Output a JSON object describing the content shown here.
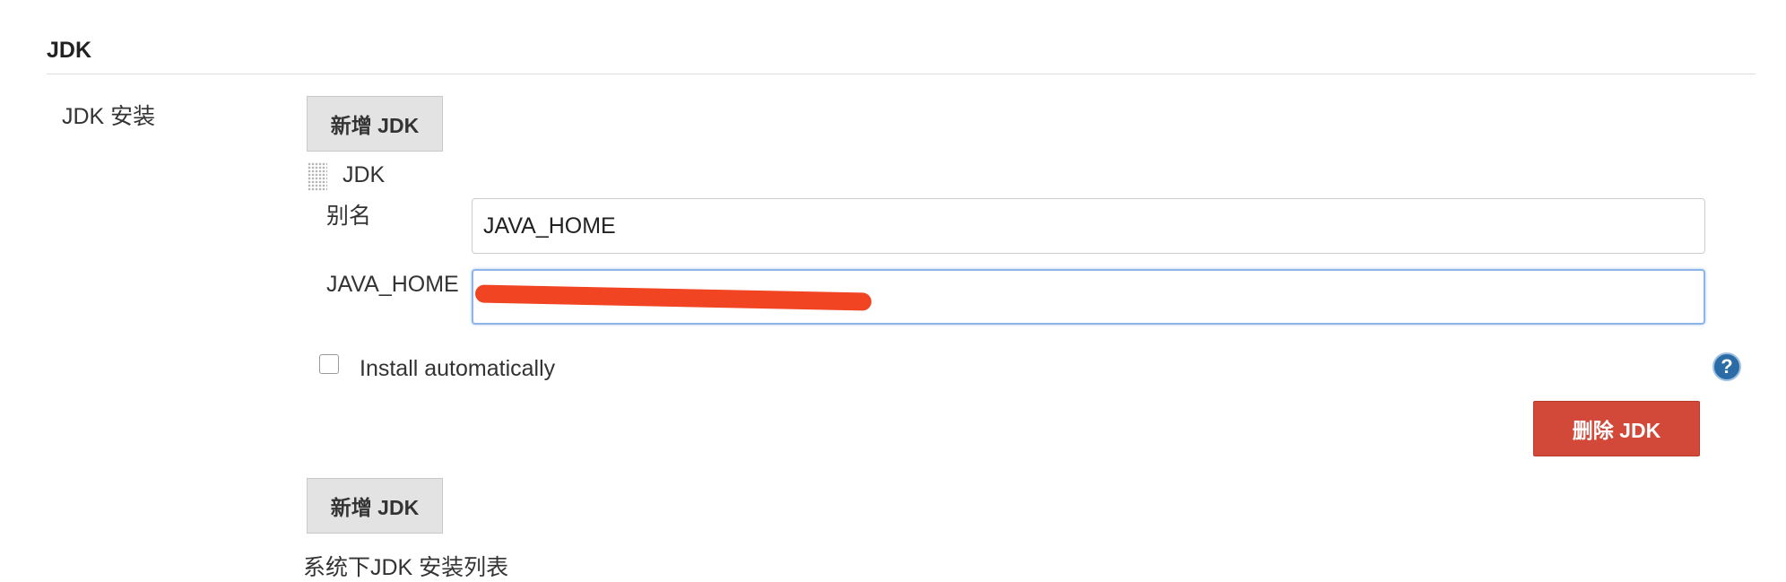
{
  "section": {
    "title": "JDK"
  },
  "jdk_installations": {
    "label": "JDK 安装",
    "add_button": "新增 JDK",
    "add_button_bottom": "新增 JDK",
    "description": "系统下JDK 安装列表",
    "item": {
      "title": "JDK",
      "alias_label": "别名",
      "alias_value": "JAVA_HOME",
      "java_home_label": "JAVA_HOME",
      "java_home_value": "",
      "install_automatically_label": "Install automatically",
      "install_automatically_checked": false,
      "help_icon": "?",
      "delete_button": "删除 JDK"
    }
  },
  "colors": {
    "delete_button": "#d24939",
    "focus_border": "#8db5e8",
    "help_icon": "#2c6ca6",
    "redaction": "#f14423"
  }
}
